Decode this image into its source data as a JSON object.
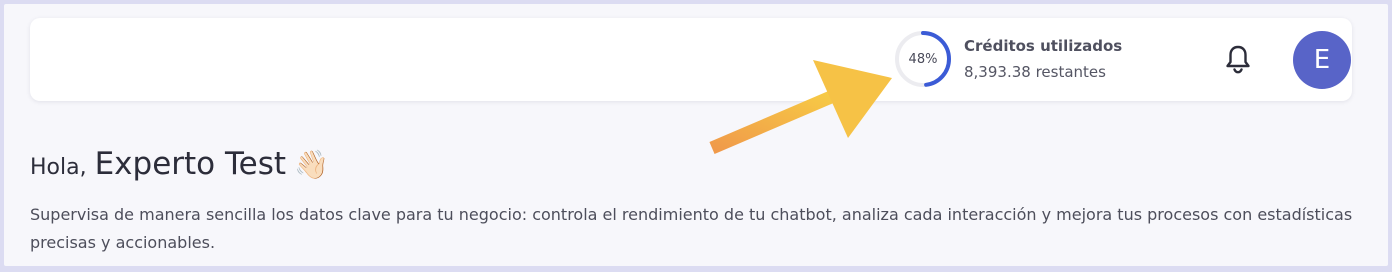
{
  "header": {
    "credits": {
      "percent_label": "48%",
      "percent_value": 0.48,
      "title": "Créditos utilizados",
      "remaining": "8,393.38 restantes"
    },
    "notifications_icon": "bell-icon",
    "avatar_initial": "E"
  },
  "main": {
    "greeting_prefix": "Hola,",
    "user_name": "Experto Test",
    "wave_emoji": "👋🏻",
    "description": "Supervisa de manera sencilla los datos clave para tu negocio: controla el rendimiento de tu chatbot, analiza cada interacción y mejora tus procesos con estadísticas precisas y accionables."
  },
  "annotation": {
    "arrow_icon": "arrow-icon",
    "arrow_color": "#f4b544"
  },
  "colors": {
    "ring_progress": "#3b5bd6",
    "ring_track": "#ececf0",
    "avatar_bg": "#5864c8"
  }
}
